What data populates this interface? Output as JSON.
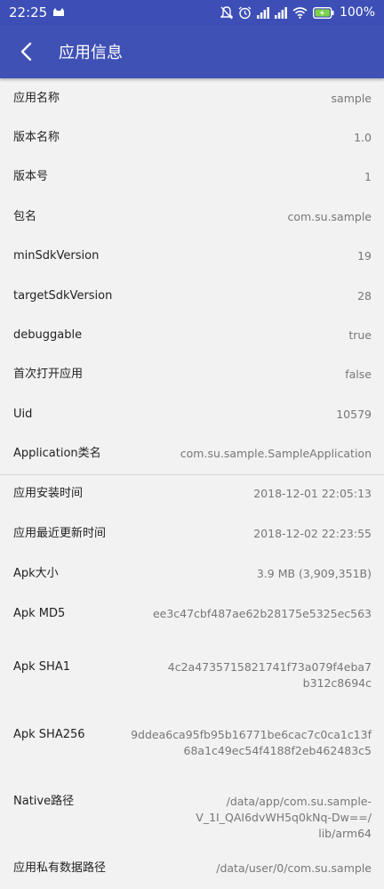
{
  "status_bar": {
    "time": "22:25",
    "battery": "100%"
  },
  "app_bar": {
    "title": "应用信息"
  },
  "rows_top": [
    {
      "label": "应用名称",
      "value": "sample"
    },
    {
      "label": "版本名称",
      "value": "1.0"
    },
    {
      "label": "版本号",
      "value": "1"
    },
    {
      "label": "包名",
      "value": "com.su.sample"
    },
    {
      "label": "minSdkVersion",
      "value": "19"
    },
    {
      "label": "targetSdkVersion",
      "value": "28"
    },
    {
      "label": "debuggable",
      "value": "true"
    },
    {
      "label": "首次打开应用",
      "value": "false"
    },
    {
      "label": "Uid",
      "value": "10579"
    },
    {
      "label": "Application类名",
      "value": "com.su.sample.SampleApplication"
    }
  ],
  "rows_bottom": [
    {
      "label": "应用安装时间",
      "value": "2018-12-01 22:05:13"
    },
    {
      "label": "应用最近更新时间",
      "value": "2018-12-02 22:23:55"
    },
    {
      "label": "Apk大小",
      "value": "3.9 MB (3,909,351B)"
    },
    {
      "label": "Apk MD5",
      "value": "ee3c47cbf487ae62b28175e5325ec563"
    },
    {
      "label": "Apk SHA1",
      "value": "4c2a4735715821741f73a079f4eba7\nb312c8694c"
    },
    {
      "label": "Apk SHA256",
      "value": "9ddea6ca95fb95b16771be6cac7c0ca1c13f\n68a1c49ec54f4188f2eb462483c5"
    },
    {
      "label": "Native路径",
      "value": "/data/app/com.su.sample-\nV_1I_QAI6dvWH5q0kNq-Dw==/\nlib/arm64"
    },
    {
      "label": "应用私有数据路径",
      "value": "/data/user/0/com.su.sample"
    }
  ],
  "colors": {
    "primary": "#3f51b5",
    "status_bar": "#3d4fb6",
    "background": "#f2f2f2",
    "battery_fill": "#7bd34a"
  }
}
